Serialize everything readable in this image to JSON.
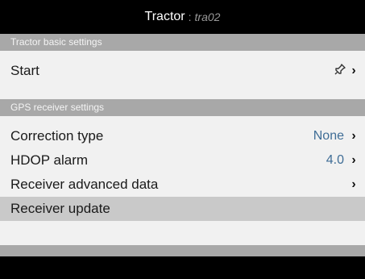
{
  "header": {
    "title": "Tractor",
    "separator": ":",
    "subtitle": "tra02"
  },
  "sections": [
    {
      "title": "Tractor basic settings",
      "rows": [
        {
          "label": "Start",
          "icon": "pin-icon",
          "chevron": "›"
        }
      ]
    },
    {
      "title": "GPS receiver settings",
      "rows": [
        {
          "label": "Correction type",
          "value": "None",
          "chevron": "›"
        },
        {
          "label": "HDOP alarm",
          "value": "4.0",
          "chevron": "›"
        },
        {
          "label": "Receiver advanced data",
          "chevron": "›"
        },
        {
          "label": "Receiver update",
          "selected": true
        }
      ]
    }
  ],
  "colors": {
    "section_bg": "#a8a8a8",
    "content_bg": "#f1f1f1",
    "value_color": "#3f6d96",
    "selected_bg": "#c9c9c9"
  }
}
